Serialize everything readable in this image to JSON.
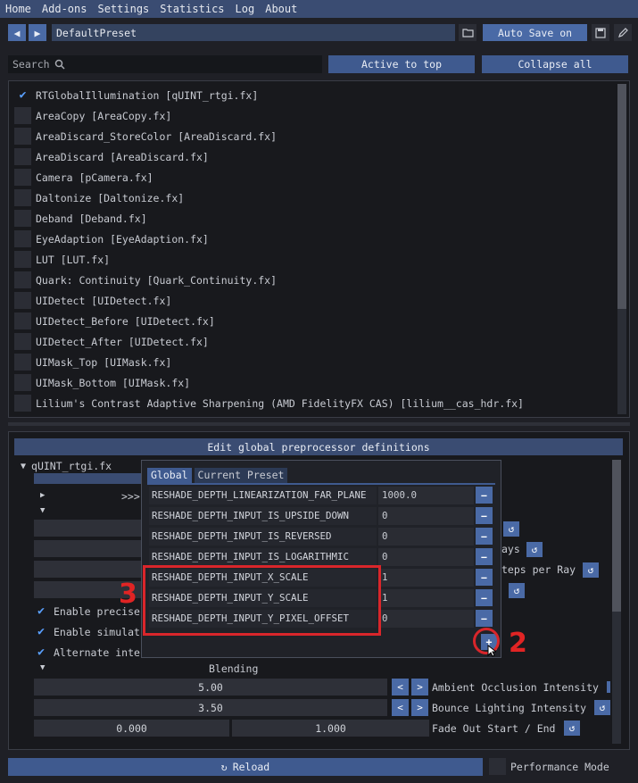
{
  "menu": [
    "Home",
    "Add-ons",
    "Settings",
    "Statistics",
    "Log",
    "About"
  ],
  "toolbar": {
    "prev": "◀",
    "next": "▶",
    "preset": "DefaultPreset",
    "autosave": "Auto Save on"
  },
  "search": {
    "label": "Search",
    "active_top": "Active to top",
    "collapse_all": "Collapse all"
  },
  "effects": [
    {
      "label": "RTGlobalIllumination [qUINT_rtgi.fx]",
      "checked": true
    },
    {
      "label": "AreaCopy [AreaCopy.fx]",
      "checked": false
    },
    {
      "label": "AreaDiscard_StoreColor [AreaDiscard.fx]",
      "checked": false
    },
    {
      "label": "AreaDiscard [AreaDiscard.fx]",
      "checked": false
    },
    {
      "label": "Camera [pCamera.fx]",
      "checked": false
    },
    {
      "label": "Daltonize [Daltonize.fx]",
      "checked": false
    },
    {
      "label": "Deband [Deband.fx]",
      "checked": false
    },
    {
      "label": "EyeAdaption [EyeAdaption.fx]",
      "checked": false
    },
    {
      "label": "LUT [LUT.fx]",
      "checked": false
    },
    {
      "label": "Quark: Continuity [Quark_Continuity.fx]",
      "checked": false
    },
    {
      "label": "UIDetect [UIDetect.fx]",
      "checked": false
    },
    {
      "label": "UIDetect_Before [UIDetect.fx]",
      "checked": false
    },
    {
      "label": "UIDetect_After [UIDetect.fx]",
      "checked": false
    },
    {
      "label": "UIMask_Top [UIMask.fx]",
      "checked": false
    },
    {
      "label": "UIMask_Bottom [UIMask.fx]",
      "checked": false
    },
    {
      "label": "Lilium's Contrast Adaptive Sharpening (AMD FidelityFX CAS) [lilium__cas_hdr.fx]",
      "checked": false
    }
  ],
  "edit_global": "Edit global preprocessor definitions",
  "effect_node": "qUINT_rtgi.fx",
  "popup": {
    "tabs": [
      "Global",
      "Current Preset"
    ],
    "defs": [
      {
        "name": "RESHADE_DEPTH_LINEARIZATION_FAR_PLANE",
        "value": "1000.0"
      },
      {
        "name": "RESHADE_DEPTH_INPUT_IS_UPSIDE_DOWN",
        "value": "0"
      },
      {
        "name": "RESHADE_DEPTH_INPUT_IS_REVERSED",
        "value": "0"
      },
      {
        "name": "RESHADE_DEPTH_INPUT_IS_LOGARITHMIC",
        "value": "0"
      },
      {
        "name": "RESHADE_DEPTH_INPUT_X_SCALE",
        "value": "1"
      },
      {
        "name": "RESHADE_DEPTH_INPUT_Y_SCALE",
        "value": "1"
      },
      {
        "name": "RESHADE_DEPTH_INPUT_Y_PIXEL_OFFSET",
        "value": "0"
      }
    ]
  },
  "behind": {
    "arrow_text": ">>>",
    "ays": "ays",
    "steps": "teps per Ray",
    "enable_precise": "Enable precise",
    "enable_simulat": "Enable simulat",
    "alternate": "Alternate inte",
    "blending": "Blending",
    "ao_value": "5.00",
    "ao_label": "Ambient Occlusion Intensity",
    "bounce_value": "3.50",
    "bounce_label": "Bounce Lighting Intensity",
    "fade_start": "0.000",
    "fade_end": "1.000",
    "fade_label": "Fade Out Start / End"
  },
  "annotations": {
    "label_3": "3",
    "label_2": "2"
  },
  "bottom": {
    "reload": "Reload",
    "performance": "Performance Mode"
  }
}
